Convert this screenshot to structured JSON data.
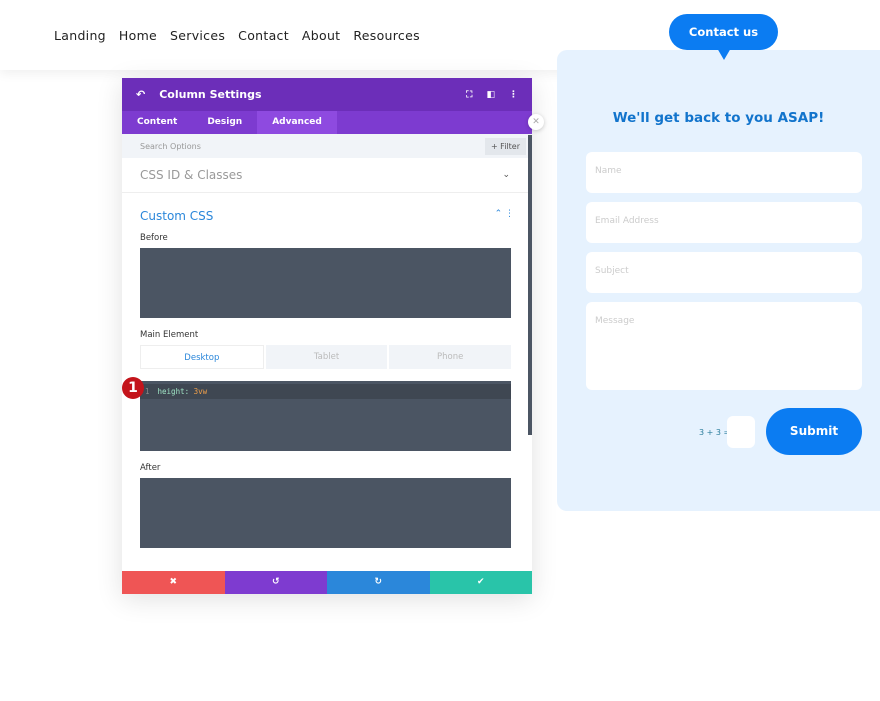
{
  "nav": [
    "Landing",
    "Home",
    "Services",
    "Contact",
    "About",
    "Resources"
  ],
  "panel": {
    "title": "Column Settings",
    "tabs": [
      "Content",
      "Design",
      "Advanced"
    ],
    "search_placeholder": "Search Options",
    "filter": "+ Filter",
    "sections": {
      "css_id": "CSS ID & Classes",
      "custom_css": "Custom CSS"
    },
    "labels": {
      "before": "Before",
      "main": "Main Element",
      "after": "After"
    },
    "devices": [
      "Desktop",
      "Tablet",
      "Phone"
    ],
    "code": {
      "line": "1",
      "prop": "height:",
      "value": "3vw"
    },
    "badge": "1",
    "footer": {
      "cancel": "✖",
      "undo": "↺",
      "redo": "↻",
      "save": "✔"
    },
    "colors": {
      "header": "#6c2eb9",
      "cancel": "#ef5555",
      "undo": "#7e3bd0",
      "redo": "#2b87da",
      "save": "#29c4a9"
    }
  },
  "form": {
    "bubble": "Contact us",
    "heading": "We'll get back to you ASAP!",
    "fields": [
      "Name",
      "Email Address",
      "Subject",
      "Message"
    ],
    "captcha": "3 + 3 =",
    "submit": "Submit",
    "accent": "#0b7cf2"
  }
}
